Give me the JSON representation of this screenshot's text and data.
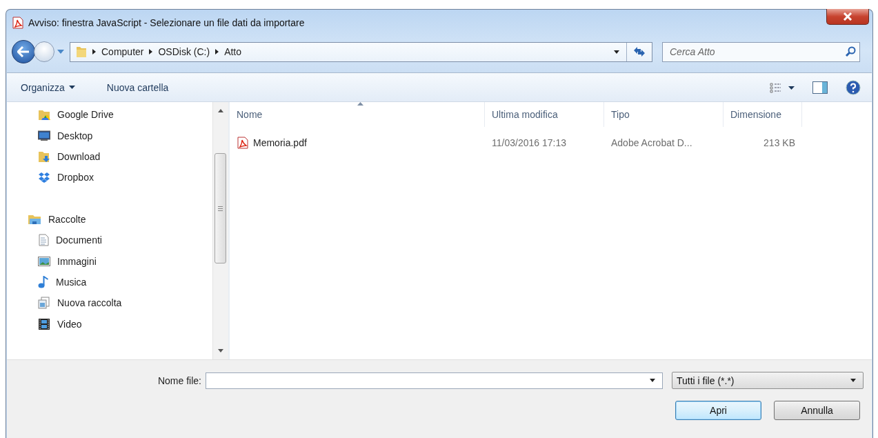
{
  "window": {
    "title": "Avviso: finestra JavaScript - Selezionare un file dati da importare"
  },
  "breadcrumb": [
    "Computer",
    "OSDisk (C:)",
    "Atto"
  ],
  "search": {
    "placeholder": "Cerca Atto"
  },
  "toolbar": {
    "organize": "Organizza",
    "new_folder": "Nuova cartella"
  },
  "sidebar": {
    "items": [
      {
        "label": "Google Drive",
        "kind": "drive"
      },
      {
        "label": "Desktop",
        "kind": "desktop"
      },
      {
        "label": "Download",
        "kind": "download"
      },
      {
        "label": "Dropbox",
        "kind": "dropbox"
      }
    ],
    "groups": [
      {
        "label": "Raccolte",
        "kind": "library",
        "children": [
          {
            "label": "Documenti",
            "kind": "documents"
          },
          {
            "label": "Immagini",
            "kind": "pictures"
          },
          {
            "label": "Musica",
            "kind": "music"
          },
          {
            "label": "Nuova raccolta",
            "kind": "newlib"
          },
          {
            "label": "Video",
            "kind": "video"
          }
        ]
      }
    ]
  },
  "table": {
    "columns": [
      {
        "label": "Nome",
        "sorted": true
      },
      {
        "label": "Ultima modifica",
        "sorted": false
      },
      {
        "label": "Tipo",
        "sorted": false
      },
      {
        "label": "Dimensione",
        "sorted": false
      }
    ],
    "rows": [
      {
        "name": "Memoria.pdf",
        "modified": "11/03/2016 17:13",
        "type": "Adobe Acrobat D...",
        "size": "213 KB",
        "selected": false
      }
    ]
  },
  "footer": {
    "filename_label": "Nome file:",
    "filter": "Tutti i file (*.*)",
    "buttons": [
      {
        "label": "Apri",
        "default": true
      },
      {
        "label": "Annulla",
        "default": false
      }
    ]
  }
}
